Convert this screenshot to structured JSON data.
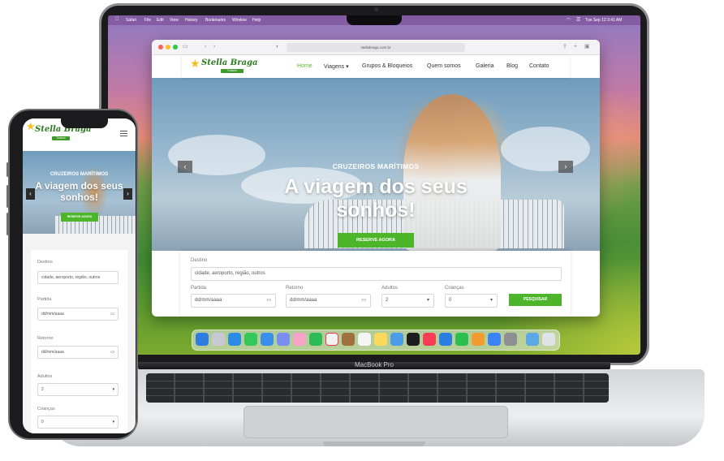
{
  "menubar": {
    "apple": "",
    "items": [
      "Safari",
      "File",
      "Edit",
      "View",
      "History",
      "Bookmarks",
      "Window",
      "Help"
    ],
    "clock": "Tue Sep 12  3:41 AM"
  },
  "browser": {
    "url": "stellabraga.com.br"
  },
  "site": {
    "logo": "Stella Braga",
    "logo_sub": "Turismo",
    "nav": [
      "Home",
      "Viagens ▾",
      "Grupos & Bloqueios",
      "Quem somos",
      "Galeria",
      "Blog",
      "Contato"
    ]
  },
  "hero": {
    "kicker": "CRUZEIROS MARÍTIMOS",
    "title_line1": "A viagem dos seus",
    "title_line2": "sonhos!",
    "button": "RESERVE AGORA",
    "prev": "‹",
    "next": "›"
  },
  "search": {
    "destino_label": "Destino",
    "destino_placeholder": "cidade, aeroporto, região, outros",
    "partida_label": "Partida",
    "retorno_label": "Retorno",
    "date_placeholder": "dd/mm/aaaa",
    "adultos_label": "Adultos",
    "adultos_value": "2",
    "criancas_label": "Crianças",
    "criancas_value": "0",
    "button": "PESQUISAR"
  },
  "laptop": {
    "model": "MacBook Pro"
  },
  "phone": {
    "hero_title_line1": "A viagem dos seus",
    "hero_title_line2": "sonhos!",
    "partida_label": "Partida",
    "retorno_label": "Retorno",
    "adultos_label": "Adultos",
    "adultos_value": "2",
    "criancas_label": "Crianças",
    "criancas_value": "0"
  }
}
